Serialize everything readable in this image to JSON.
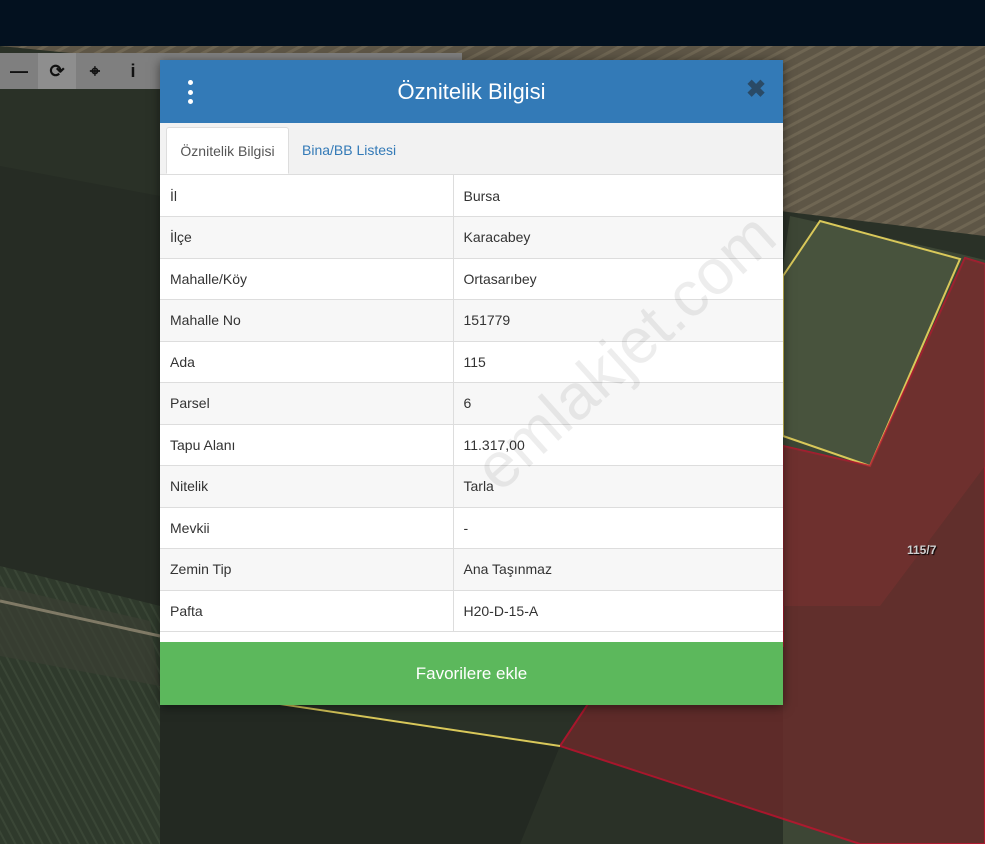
{
  "map": {
    "parcel_label": "115/7",
    "toolbar": {
      "tools": [
        {
          "name": "zoom-out-icon",
          "glyph": "—"
        },
        {
          "name": "refresh-icon",
          "glyph": "⟳"
        },
        {
          "name": "locate-icon",
          "glyph": "⌖"
        },
        {
          "name": "info-icon",
          "glyph": "i"
        }
      ]
    }
  },
  "dialog": {
    "title": "Öznitelik Bilgisi",
    "tabs": [
      {
        "label": "Öznitelik Bilgisi",
        "active": true
      },
      {
        "label": "Bina/BB Listesi",
        "active": false
      }
    ],
    "rows": [
      {
        "key": "İl",
        "value": "Bursa"
      },
      {
        "key": "İlçe",
        "value": "Karacabey"
      },
      {
        "key": "Mahalle/Köy",
        "value": "Ortasarıbey"
      },
      {
        "key": "Mahalle No",
        "value": "151779"
      },
      {
        "key": "Ada",
        "value": "115"
      },
      {
        "key": "Parsel",
        "value": "6"
      },
      {
        "key": "Tapu Alanı",
        "value": "11.317,00"
      },
      {
        "key": "Nitelik",
        "value": "Tarla"
      },
      {
        "key": "Mevkii",
        "value": "-"
      },
      {
        "key": "Zemin Tip",
        "value": "Ana Taşınmaz"
      },
      {
        "key": "Pafta",
        "value": "H20-D-15-A"
      }
    ],
    "favorite_button": "Favorilere ekle",
    "close_glyph": "✖"
  },
  "watermark": "emlakjet.com",
  "colors": {
    "header": "#337ab7",
    "favorite": "#5cb85c",
    "topbar": "#03111f",
    "parcel_outline": "#c8102e",
    "neighbor_outline": "#d9c85a"
  }
}
